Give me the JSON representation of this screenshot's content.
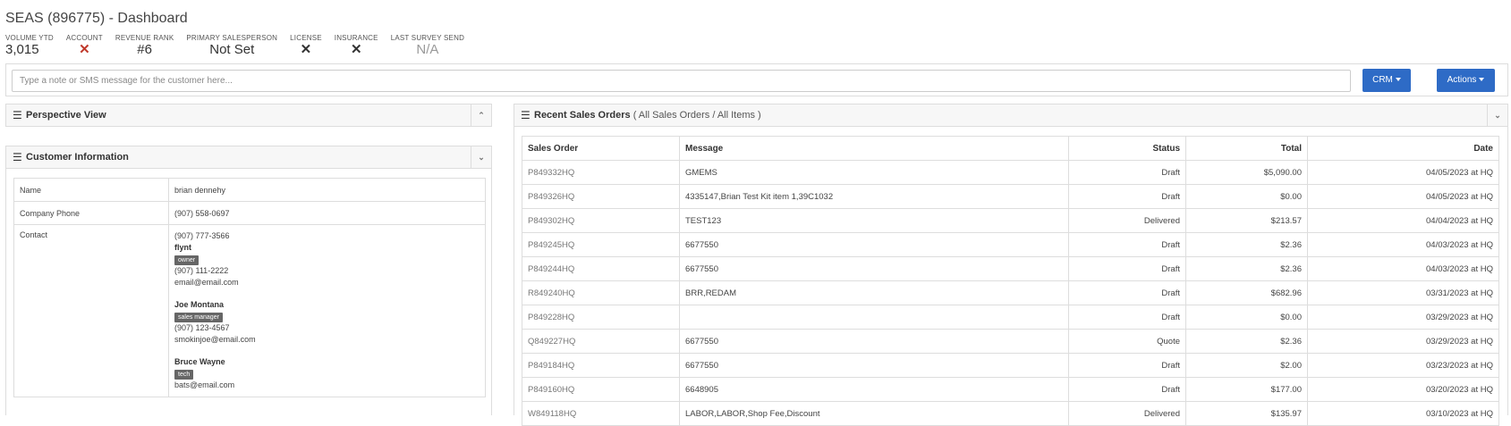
{
  "header": {
    "title": "SEAS (896775) - Dashboard"
  },
  "stats": [
    {
      "label": "VOLUME YTD",
      "value": "3,015"
    },
    {
      "label": "ACCOUNT",
      "value": "✕"
    },
    {
      "label": "REVENUE RANK",
      "value": "#6"
    },
    {
      "label": "PRIMARY SALESPERSON",
      "value": "Not Set"
    },
    {
      "label": "LICENSE",
      "value": "✕"
    },
    {
      "label": "INSURANCE",
      "value": "✕"
    },
    {
      "label": "LAST SURVEY SEND",
      "value": "N/A"
    }
  ],
  "note": {
    "placeholder": "Type a note or SMS message for the customer here..."
  },
  "buttons": {
    "crm": "CRM",
    "actions": "Actions"
  },
  "panels": {
    "perspective": "Perspective View",
    "customer": "Customer Information",
    "orders_title": "Recent Sales Orders",
    "orders_sub": "( All Sales Orders / All Items )"
  },
  "customer": {
    "name_label": "Name",
    "name": "brian dennehy",
    "phone_label": "Company Phone",
    "phone": "(907) 558-0697",
    "contact_label": "Contact",
    "contacts": [
      {
        "phone": "(907) 777-3566"
      },
      {
        "name": "flynt",
        "badge": "owner",
        "phone": "(907) 111-2222",
        "email": "email@email.com"
      },
      {
        "name": "Joe Montana",
        "badge": "sales manager",
        "phone": "(907) 123-4567",
        "email": "smokinjoe@email.com"
      },
      {
        "name": "Bruce Wayne",
        "badge": "tech",
        "email": "bats@email.com"
      }
    ]
  },
  "orders": {
    "headers": [
      "Sales Order",
      "Message",
      "Status",
      "Total",
      "Date"
    ],
    "rows": [
      [
        "P849332HQ",
        "GMEMS",
        "Draft",
        "$5,090.00",
        "04/05/2023 at HQ"
      ],
      [
        "P849326HQ",
        "4335147,Brian Test Kit item 1,39C1032",
        "Draft",
        "$0.00",
        "04/05/2023 at HQ"
      ],
      [
        "P849302HQ",
        "TEST123",
        "Delivered",
        "$213.57",
        "04/04/2023 at HQ"
      ],
      [
        "P849245HQ",
        "6677550",
        "Draft",
        "$2.36",
        "04/03/2023 at HQ"
      ],
      [
        "P849244HQ",
        "6677550",
        "Draft",
        "$2.36",
        "04/03/2023 at HQ"
      ],
      [
        "R849240HQ",
        "BRR,REDAM",
        "Draft",
        "$682.96",
        "03/31/2023 at HQ"
      ],
      [
        "P849228HQ",
        "",
        "Draft",
        "$0.00",
        "03/29/2023 at HQ"
      ],
      [
        "Q849227HQ",
        "6677550",
        "Quote",
        "$2.36",
        "03/29/2023 at HQ"
      ],
      [
        "P849184HQ",
        "6677550",
        "Draft",
        "$2.00",
        "03/23/2023 at HQ"
      ],
      [
        "P849160HQ",
        "6648905",
        "Draft",
        "$177.00",
        "03/20/2023 at HQ"
      ],
      [
        "W849118HQ",
        "LABOR,LABOR,Shop Fee,Discount",
        "Delivered",
        "$135.97",
        "03/10/2023 at HQ"
      ]
    ]
  }
}
